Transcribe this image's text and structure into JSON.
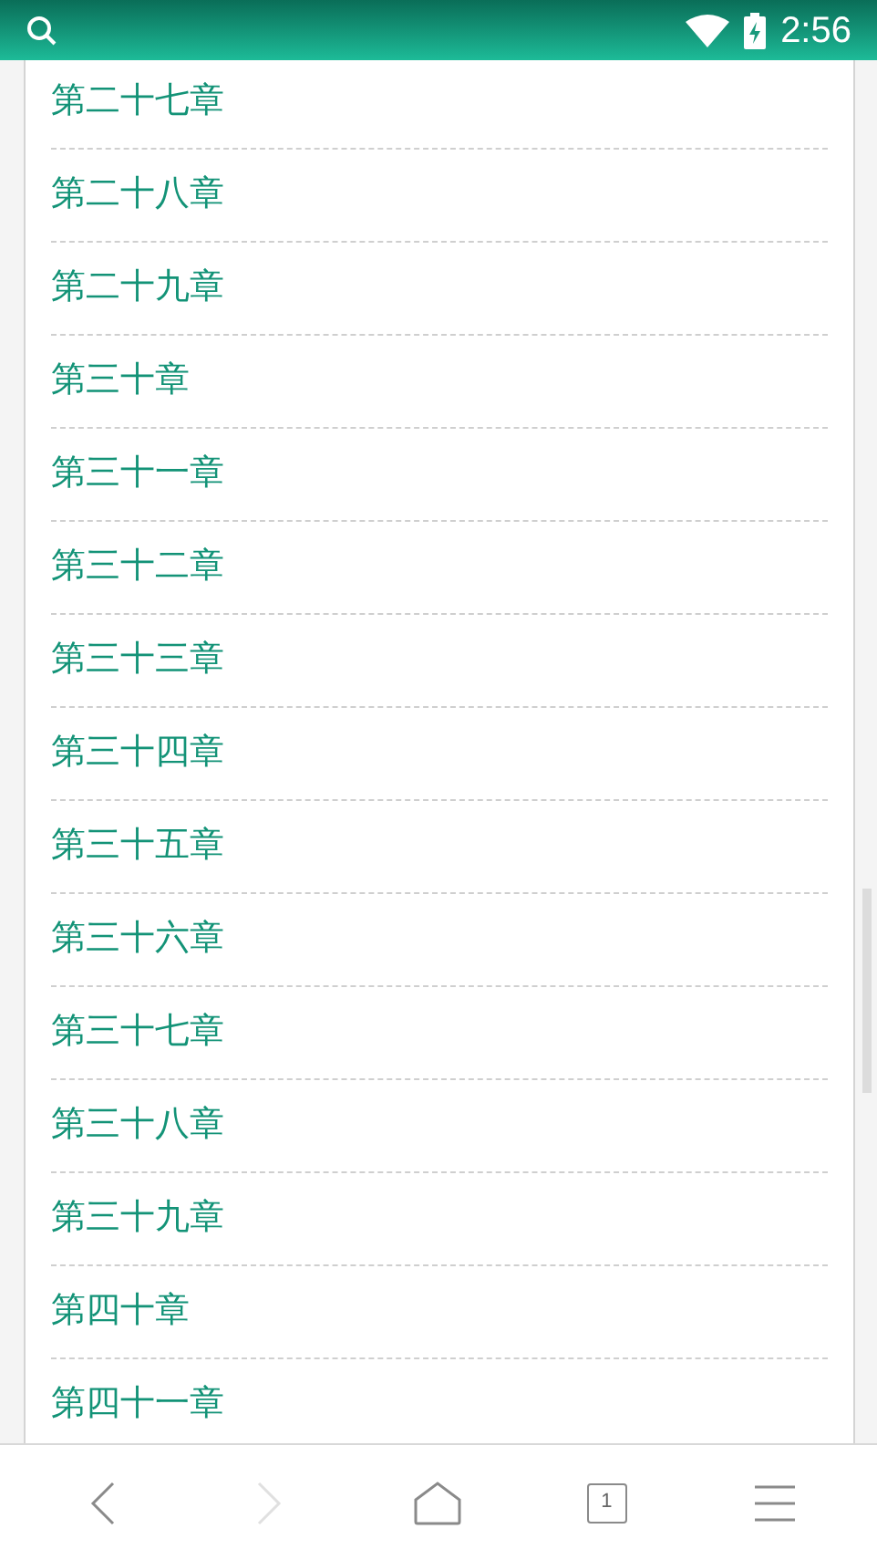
{
  "status_bar": {
    "time": "2:56"
  },
  "chapters": [
    {
      "title": "第二十七章"
    },
    {
      "title": "第二十八章"
    },
    {
      "title": "第二十九章"
    },
    {
      "title": "第三十章"
    },
    {
      "title": "第三十一章"
    },
    {
      "title": "第三十二章"
    },
    {
      "title": "第三十三章"
    },
    {
      "title": "第三十四章"
    },
    {
      "title": "第三十五章"
    },
    {
      "title": "第三十六章"
    },
    {
      "title": "第三十七章"
    },
    {
      "title": "第三十八章"
    },
    {
      "title": "第三十九章"
    },
    {
      "title": "第四十章"
    },
    {
      "title": "第四十一章"
    }
  ],
  "toolbar": {
    "back": {
      "disabled": false
    },
    "forward": {
      "disabled": true
    },
    "tab_count": "1"
  }
}
